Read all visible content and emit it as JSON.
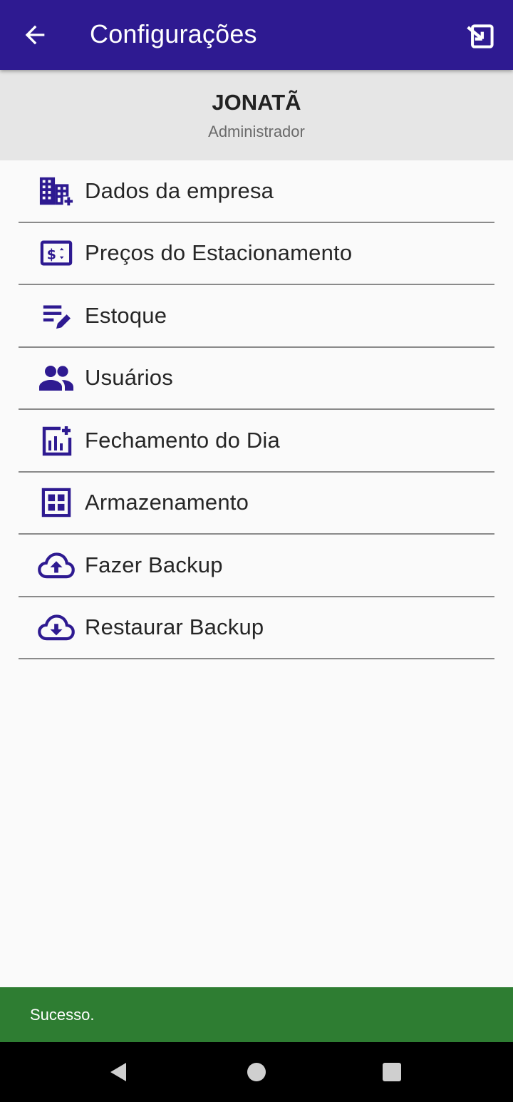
{
  "appbar": {
    "title": "Configurações",
    "back_icon": "arrow-back-icon",
    "exit_icon": "exit-to-app-icon",
    "background_color": "#2e1a91"
  },
  "user": {
    "name": "JONATÃ",
    "role": "Administrador"
  },
  "menu": {
    "icon_color": "#2e1a91",
    "items": [
      {
        "label": "Dados da empresa",
        "icon": "domain-add-icon"
      },
      {
        "label": "Preços do Estacionamento",
        "icon": "price-tag-icon"
      },
      {
        "label": "Estoque",
        "icon": "edit-list-icon"
      },
      {
        "label": "Usuários",
        "icon": "people-icon"
      },
      {
        "label": "Fechamento do Dia",
        "icon": "chart-add-icon"
      },
      {
        "label": "Armazenamento",
        "icon": "grid-icon"
      },
      {
        "label": "Fazer Backup",
        "icon": "cloud-upload-icon"
      },
      {
        "label": "Restaurar Backup",
        "icon": "cloud-download-icon"
      }
    ]
  },
  "snackbar": {
    "message": "Sucesso.",
    "color": "#2e7d32"
  },
  "system_nav": {
    "back_icon": "nav-back-icon",
    "home_icon": "nav-home-icon",
    "recents_icon": "nav-recents-icon"
  }
}
